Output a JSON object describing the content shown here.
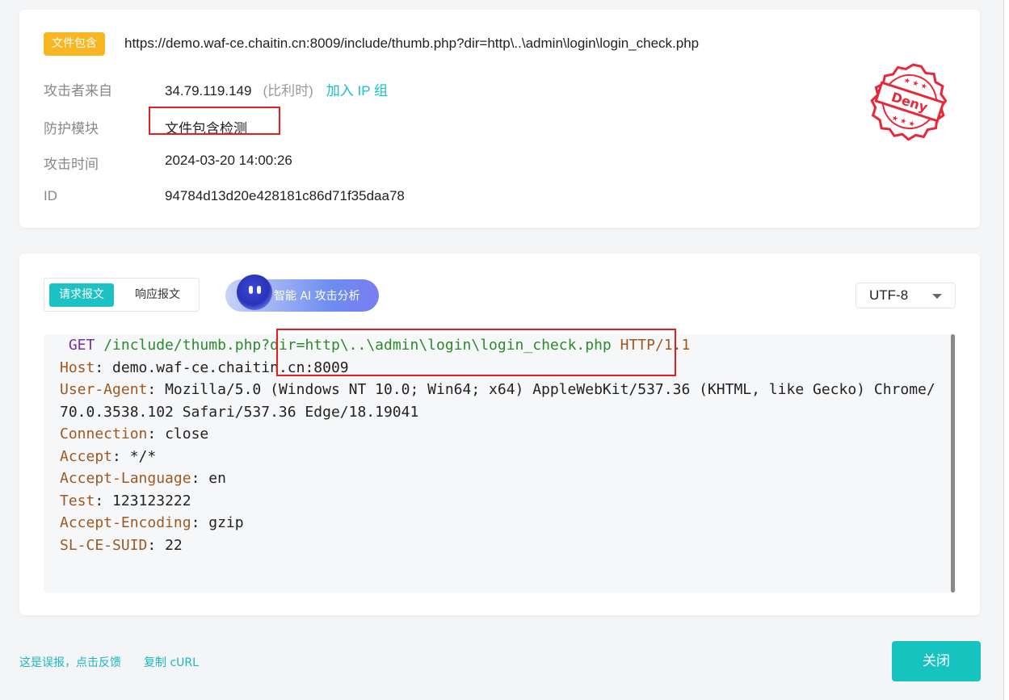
{
  "header": {
    "tag": "文件包含",
    "url": "https://demo.waf-ce.chaitin.cn:8009/include/thumb.php?dir=http\\..\\admin\\login\\login_check.php"
  },
  "details": [
    {
      "label": "攻击者来自",
      "value": "34.79.119.149"
    },
    {
      "label": "防护模块",
      "value": "文件包含检测"
    },
    {
      "label": "攻击时间",
      "value": "2024-03-20 14:00:26"
    },
    {
      "label": "ID",
      "value": "94784d13d20e428181c86d71f35daa78"
    }
  ],
  "attacker_region": "(比利时)",
  "add_ip_group": "加入 IP 组",
  "stamp": {
    "text": "Deny",
    "color": "#e8283a"
  },
  "tabs": {
    "request": "请求报文",
    "response": "响应报文"
  },
  "ai_button": "智能 AI 攻击分析",
  "encoding": "UTF-8",
  "request": {
    "method": "GET",
    "path_a": "/include/thumb.php",
    "path_b": "?dir=http\\..\\admin\\login\\login_check.php",
    "protocol": "HTTP/1.1",
    "headers": [
      {
        "name": "Host",
        "value": "demo.waf-ce.chaitin.cn:8009"
      },
      {
        "name": "User-Agent",
        "value": "Mozilla/5.0 (Windows NT 10.0; Win64; x64) AppleWebKit/537.36 (KHTML, like Gecko) Chrome/70.0.3538.102 Safari/537.36 Edge/18.19041"
      },
      {
        "name": "Connection",
        "value": "close"
      },
      {
        "name": "Accept",
        "value": "*/*"
      },
      {
        "name": "Accept-Language",
        "value": "en"
      },
      {
        "name": "Test",
        "value": "123123222"
      },
      {
        "name": "Accept-Encoding",
        "value": "gzip"
      },
      {
        "name": "SL-CE-SUID",
        "value": "22"
      }
    ]
  },
  "footer": {
    "false_positive": "这是误报，点击反馈",
    "copy_curl": "复制 cURL",
    "close": "关闭"
  },
  "colors": {
    "accent": "#17c3bf",
    "tag": "#f8b620",
    "highlight": "#e51e1e"
  }
}
